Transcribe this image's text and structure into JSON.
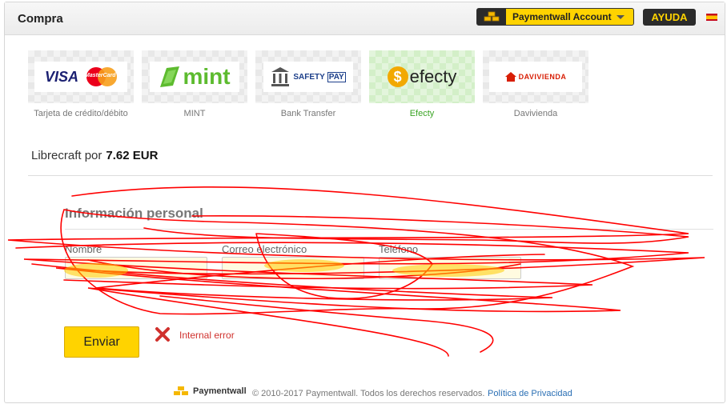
{
  "window": {
    "title": "Compra"
  },
  "header": {
    "account_label": "Paymentwall Account",
    "help_label": "AYUDA",
    "language_flag": "es-flag-icon"
  },
  "payment_methods": [
    {
      "caption": "Tarjeta de crédito/débito",
      "logo_text_1": "VISA",
      "logo_text_2": "MasterCard",
      "active": false
    },
    {
      "caption": "MINT",
      "logo_text": "mint",
      "active": false
    },
    {
      "caption": "Bank Transfer",
      "logo_text": "SAFETY",
      "logo_text_2": "PAY",
      "active": false
    },
    {
      "caption": "Efecty",
      "logo_text": "efecty",
      "active": true
    },
    {
      "caption": "Davivienda",
      "logo_text": "DAVIVIENDA",
      "active": false
    }
  ],
  "product": {
    "name_prefix": "Librecraft por",
    "amount": "7.62 EUR"
  },
  "form": {
    "section_title": "Información personal",
    "fields": [
      {
        "label": "Nombre"
      },
      {
        "label": "Correo electrónico"
      },
      {
        "label": "Teléfono"
      }
    ],
    "submit_label": "Enviar",
    "error_text": "Internal error"
  },
  "footer": {
    "brand": "Paymentwall",
    "copyright": "© 2010-2017 Paymentwall. Todos los derechos reservados.",
    "privacy_link": "Política de Privacidad"
  },
  "colors": {
    "accent_yellow": "#ffd300",
    "dark": "#2b2b2b",
    "active_green": "#3aa424",
    "error_red": "#d0312d",
    "scribble_red": "#ff0000"
  }
}
